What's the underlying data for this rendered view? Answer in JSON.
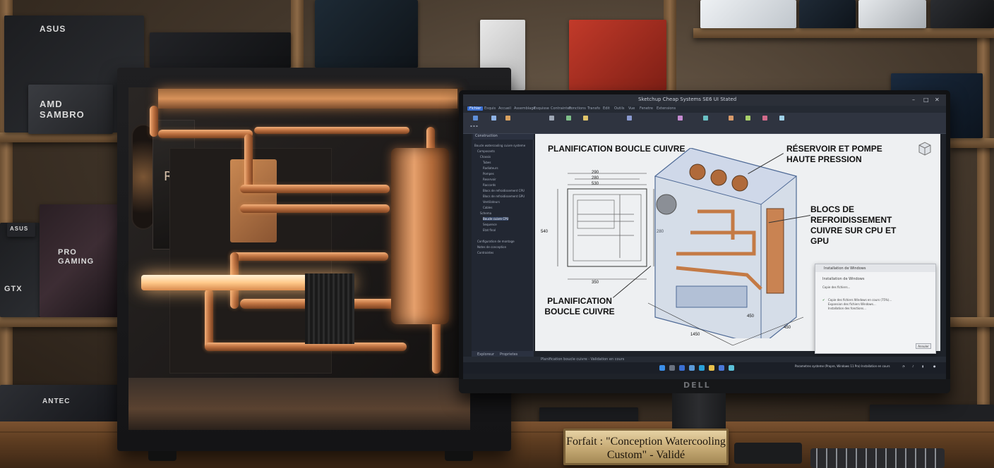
{
  "shelf_boxes": {
    "asus_top": "ASUS",
    "amd_box": "AMD SAMBRO",
    "asus_mid": "ASUS",
    "gtx_box": "GTX",
    "pro_gaming_box": "PRO GAMING",
    "antec_box": "ANTEC"
  },
  "pc_case": {
    "brand_mark": "ROG"
  },
  "app": {
    "title": "Sketchup Cheap Systems SE6 UI Stated",
    "ribbon_tabs": [
      "Fichier",
      "Esquis",
      "Accueil",
      "Assemblage",
      "Esquisse",
      "Contraintes",
      "Fonctions",
      "Transfo",
      "Edit",
      "Outils",
      "Vue",
      "Fenetre",
      "Extensions"
    ],
    "tree_header": "Construction",
    "tree_items": [
      "Boucle watercooling cuivre systeme",
      "Composants",
      "Chassis",
      "Tubes",
      "Radiateurs",
      "Pompes",
      "Reservoir",
      "Raccords",
      "Blocs de refroidissement CPU",
      "Blocs de refroidissement GPU",
      "Ventilateurs",
      "Cables",
      "Schema",
      "Boucle cuivre CPU",
      "Sequence",
      "Etat final",
      "Configuration de montage",
      "Notes de conception",
      "Contraintes"
    ],
    "tree_bottom_tabs": [
      "Exploreur",
      "Proprietes"
    ],
    "status_text": "Planification boucle cuivre - Validation en cours"
  },
  "cad": {
    "main_title": "PLANIFICATION BOUCLE CUIVRE",
    "label_reservoir": "RÉSERVOIR ET POMPE HAUTE PRESSION",
    "label_blocs": "BLOCS DE REFROIDISSEMENT CUIVRE SUR CPU ET GPU",
    "label_planif": "PLANIFICATION BOUCLE CUIVRE",
    "dims": {
      "top1": "290",
      "top2": "280",
      "top3": "530",
      "left": "540",
      "right": "280",
      "bottom": "350",
      "iso1": "450",
      "iso2": "450",
      "iso3": "1450"
    }
  },
  "dialog": {
    "title": "Installation de Windows",
    "heading": "Installation de Windows",
    "line1": "Copie des fichiers...",
    "line2": "Copie des fichiers Windows en cours (75%)...",
    "line3": "Expansion des fichiers Windows...",
    "line4": "Installation des fonctions...",
    "button": "Annuler"
  },
  "taskbar": {
    "tray_text": "Parametres systeme (Propre, Windows 11 Pro) Installation en cours"
  },
  "monitor": {
    "brand": "DELL"
  },
  "plaque": {
    "line1": "Forfait : \"Conception Watercooling",
    "line2": "Custom\" - Validé"
  }
}
